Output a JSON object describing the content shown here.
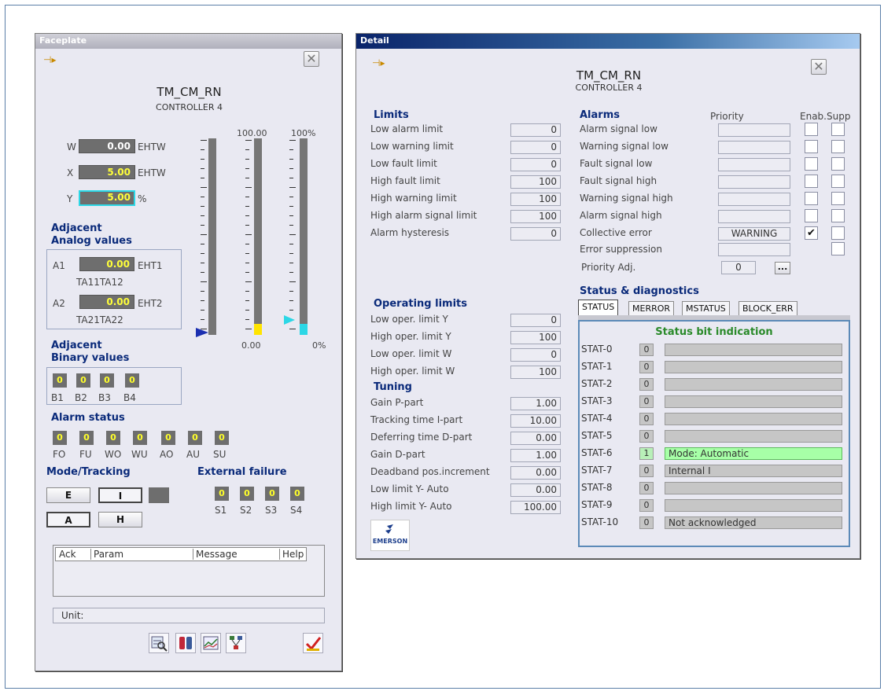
{
  "faceplate": {
    "title": "Faceplate",
    "tag": "TM_CM_RN",
    "subtitle": "CONTROLLER 4",
    "scale_top_value": "100.00",
    "scale_top_pct": "100%",
    "scale_bottom_value": "0.00",
    "scale_bottom_pct": "0%",
    "w": {
      "label": "W",
      "value": "0.00",
      "unit": "EHTW"
    },
    "x": {
      "label": "X",
      "value": "5.00",
      "unit": "EHTW"
    },
    "y": {
      "label": "Y",
      "value": "5.00",
      "unit": "%"
    },
    "adjacent_analog": {
      "title_line1": "Adjacent",
      "title_line2": "Analog values",
      "a1": {
        "label": "A1",
        "value": "0.00",
        "unit": "EHT1",
        "tag": "TA11TA12"
      },
      "a2": {
        "label": "A2",
        "value": "0.00",
        "unit": "EHT2",
        "tag": "TA21TA22"
      }
    },
    "adjacent_binary": {
      "title_line1": "Adjacent",
      "title_line2": "Binary values",
      "items": [
        {
          "label": "B1",
          "value": "0"
        },
        {
          "label": "B2",
          "value": "0"
        },
        {
          "label": "B3",
          "value": "0"
        },
        {
          "label": "B4",
          "value": "0"
        }
      ]
    },
    "alarm_status": {
      "title": "Alarm status",
      "items": [
        {
          "label": "FO",
          "value": "0"
        },
        {
          "label": "FU",
          "value": "0"
        },
        {
          "label": "WO",
          "value": "0"
        },
        {
          "label": "WU",
          "value": "0"
        },
        {
          "label": "AO",
          "value": "0"
        },
        {
          "label": "AU",
          "value": "0"
        },
        {
          "label": "SU",
          "value": "0"
        }
      ]
    },
    "mode_tracking": {
      "title": "Mode/Tracking",
      "btn_e": "E",
      "btn_i": "I",
      "btn_a": "A",
      "btn_h": "H"
    },
    "external_failure": {
      "title": "External failure",
      "items": [
        {
          "label": "S1",
          "value": "0"
        },
        {
          "label": "S2",
          "value": "0"
        },
        {
          "label": "S3",
          "value": "0"
        },
        {
          "label": "S4",
          "value": "0"
        }
      ]
    },
    "message_table": {
      "columns": [
        "Ack",
        "Param",
        "Message",
        "Help"
      ]
    },
    "unit_label": "Unit:",
    "toolbar_icons": [
      "trend-search-icon",
      "cylinder-icon",
      "chart-icon",
      "network-icon",
      "acknowledge-check-icon"
    ]
  },
  "detail": {
    "title": "Detail",
    "tag": "TM_CM_RN",
    "subtitle": "CONTROLLER 4",
    "limits": {
      "title": "Limits",
      "rows": [
        {
          "label": "Low alarm limit",
          "value": "0"
        },
        {
          "label": "Low warning limit",
          "value": "0"
        },
        {
          "label": "Low fault limit",
          "value": "0"
        },
        {
          "label": "High fault limit",
          "value": "100"
        },
        {
          "label": "High warning limit",
          "value": "100"
        },
        {
          "label": "High alarm signal limit",
          "value": "100"
        },
        {
          "label": "Alarm hysteresis",
          "value": "0"
        }
      ]
    },
    "alarms": {
      "title": "Alarms",
      "col_priority": "Priority",
      "col_enab_supp": "Enab.Supp",
      "rows": [
        {
          "label": "Alarm signal low",
          "priority": "",
          "enab": "",
          "supp": ""
        },
        {
          "label": "Warning signal low",
          "priority": "",
          "enab": "",
          "supp": ""
        },
        {
          "label": "Fault signal low",
          "priority": "",
          "enab": "",
          "supp": ""
        },
        {
          "label": "Fault signal high",
          "priority": "",
          "enab": "",
          "supp": ""
        },
        {
          "label": "Warning signal high",
          "priority": "",
          "enab": "",
          "supp": ""
        },
        {
          "label": "Alarm signal high",
          "priority": "",
          "enab": "",
          "supp": ""
        },
        {
          "label": "Collective error",
          "priority": "WARNING",
          "enab": "✔",
          "supp": ""
        }
      ],
      "error_suppression": "Error suppression",
      "priority_adj_label": "Priority Adj.",
      "priority_adj_value": "0",
      "priority_adj_btn": "..."
    },
    "operating_limits": {
      "title": "Operating limits",
      "rows": [
        {
          "label": "Low oper. limit Y",
          "value": "0"
        },
        {
          "label": "High oper. limit Y",
          "value": "100"
        },
        {
          "label": "Low oper. limit W",
          "value": "0"
        },
        {
          "label": "High oper. limit W",
          "value": "100"
        }
      ]
    },
    "tuning": {
      "title": "Tuning",
      "rows": [
        {
          "label": "Gain P-part",
          "value": "1.00"
        },
        {
          "label": "Tracking time I-part",
          "value": "10.00"
        },
        {
          "label": "Deferring time D-part",
          "value": "0.00"
        },
        {
          "label": "Gain D-part",
          "value": "1.00"
        },
        {
          "label": "Deadband pos.increment",
          "value": "0.00"
        },
        {
          "label": "Low limit Y- Auto",
          "value": "0.00"
        },
        {
          "label": "High limit Y- Auto",
          "value": "100.00"
        }
      ]
    },
    "status": {
      "title": "Status & diagnostics",
      "tabs": [
        "STATUS",
        "MERROR",
        "MSTATUS",
        "BLOCK_ERR"
      ],
      "panel_title": "Status bit indication",
      "rows": [
        {
          "label": "STAT-0",
          "bit": "0",
          "msg": ""
        },
        {
          "label": "STAT-1",
          "bit": "0",
          "msg": ""
        },
        {
          "label": "STAT-2",
          "bit": "0",
          "msg": ""
        },
        {
          "label": "STAT-3",
          "bit": "0",
          "msg": ""
        },
        {
          "label": "STAT-4",
          "bit": "0",
          "msg": ""
        },
        {
          "label": "STAT-5",
          "bit": "0",
          "msg": ""
        },
        {
          "label": "STAT-6",
          "bit": "1",
          "msg": "Mode: Automatic"
        },
        {
          "label": "STAT-7",
          "bit": "0",
          "msg": "Internal I"
        },
        {
          "label": "STAT-8",
          "bit": "0",
          "msg": ""
        },
        {
          "label": "STAT-9",
          "bit": "0",
          "msg": ""
        },
        {
          "label": "STAT-10",
          "bit": "0",
          "msg": "Not acknowledged"
        }
      ]
    },
    "logo_text": "EMERSON"
  },
  "colors": {
    "header_blue": "#0a2a7a",
    "value_yellow": "#ffff3a",
    "highlight_cyan": "#2cd7e6",
    "status_on_green": "#a7ffa7"
  }
}
